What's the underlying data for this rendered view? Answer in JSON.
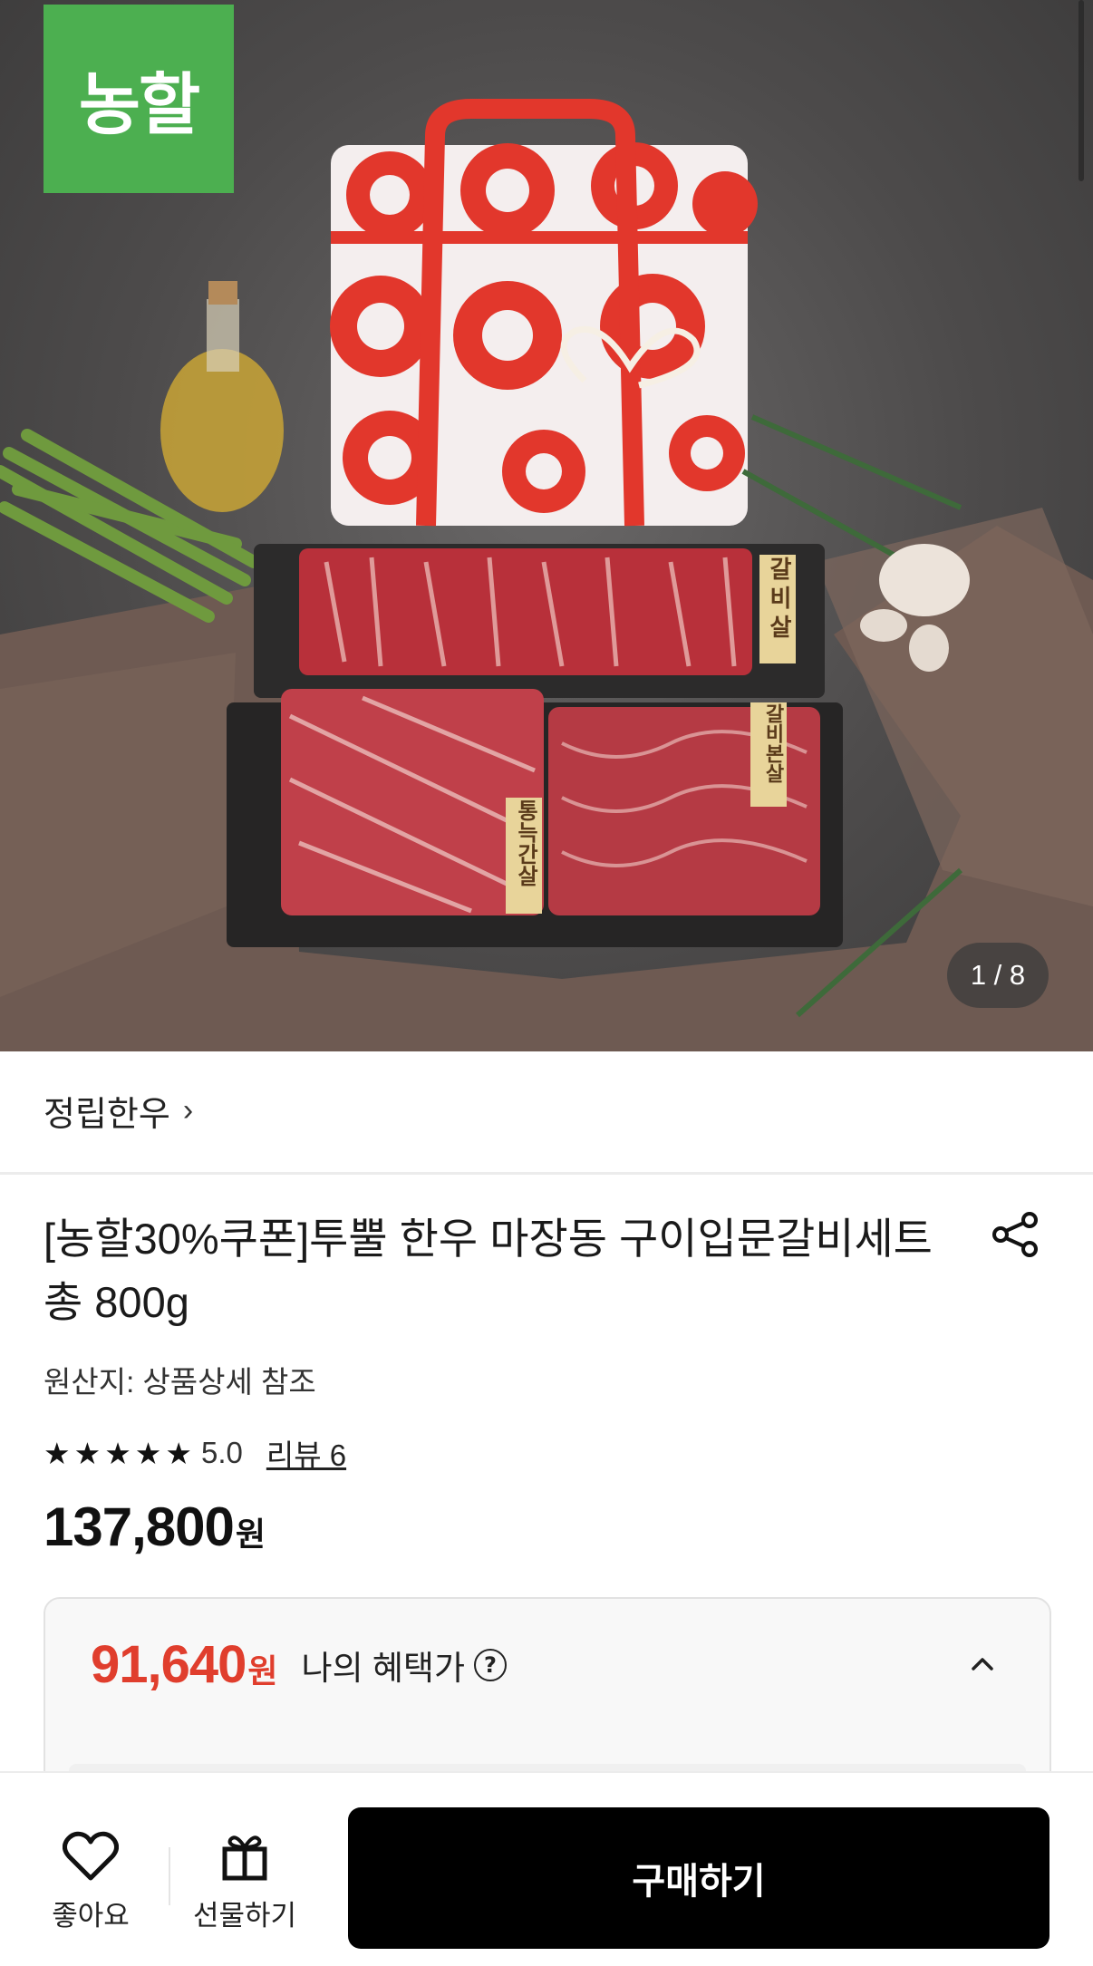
{
  "gallery": {
    "brand_logo": "농할",
    "counter": "1 / 8",
    "meat_labels": [
      "갈비살",
      "갈비본살",
      "통늑간살"
    ]
  },
  "store": {
    "name": "정립한우",
    "chevron": "›"
  },
  "product": {
    "title": "[농할30%쿠폰]투뿔 한우 마장동 구이입문갈비세트 총 800g",
    "origin": "원산지: 상품상세 참조",
    "rating": {
      "stars": 5,
      "score": "5.0",
      "review_link": "리뷰 6"
    },
    "price": {
      "amount": "137,800",
      "unit": "원"
    }
  },
  "benefit": {
    "amount": "91,640",
    "unit": "원",
    "label": "나의 혜택가",
    "help_symbol": "?",
    "expanded": true
  },
  "bottom_bar": {
    "like_label": "좋아요",
    "gift_label": "선물하기",
    "buy_label": "구매하기"
  },
  "colors": {
    "brand_green": "#4caf50",
    "benefit_red": "#e03e2d",
    "buy_button": "#000000"
  }
}
